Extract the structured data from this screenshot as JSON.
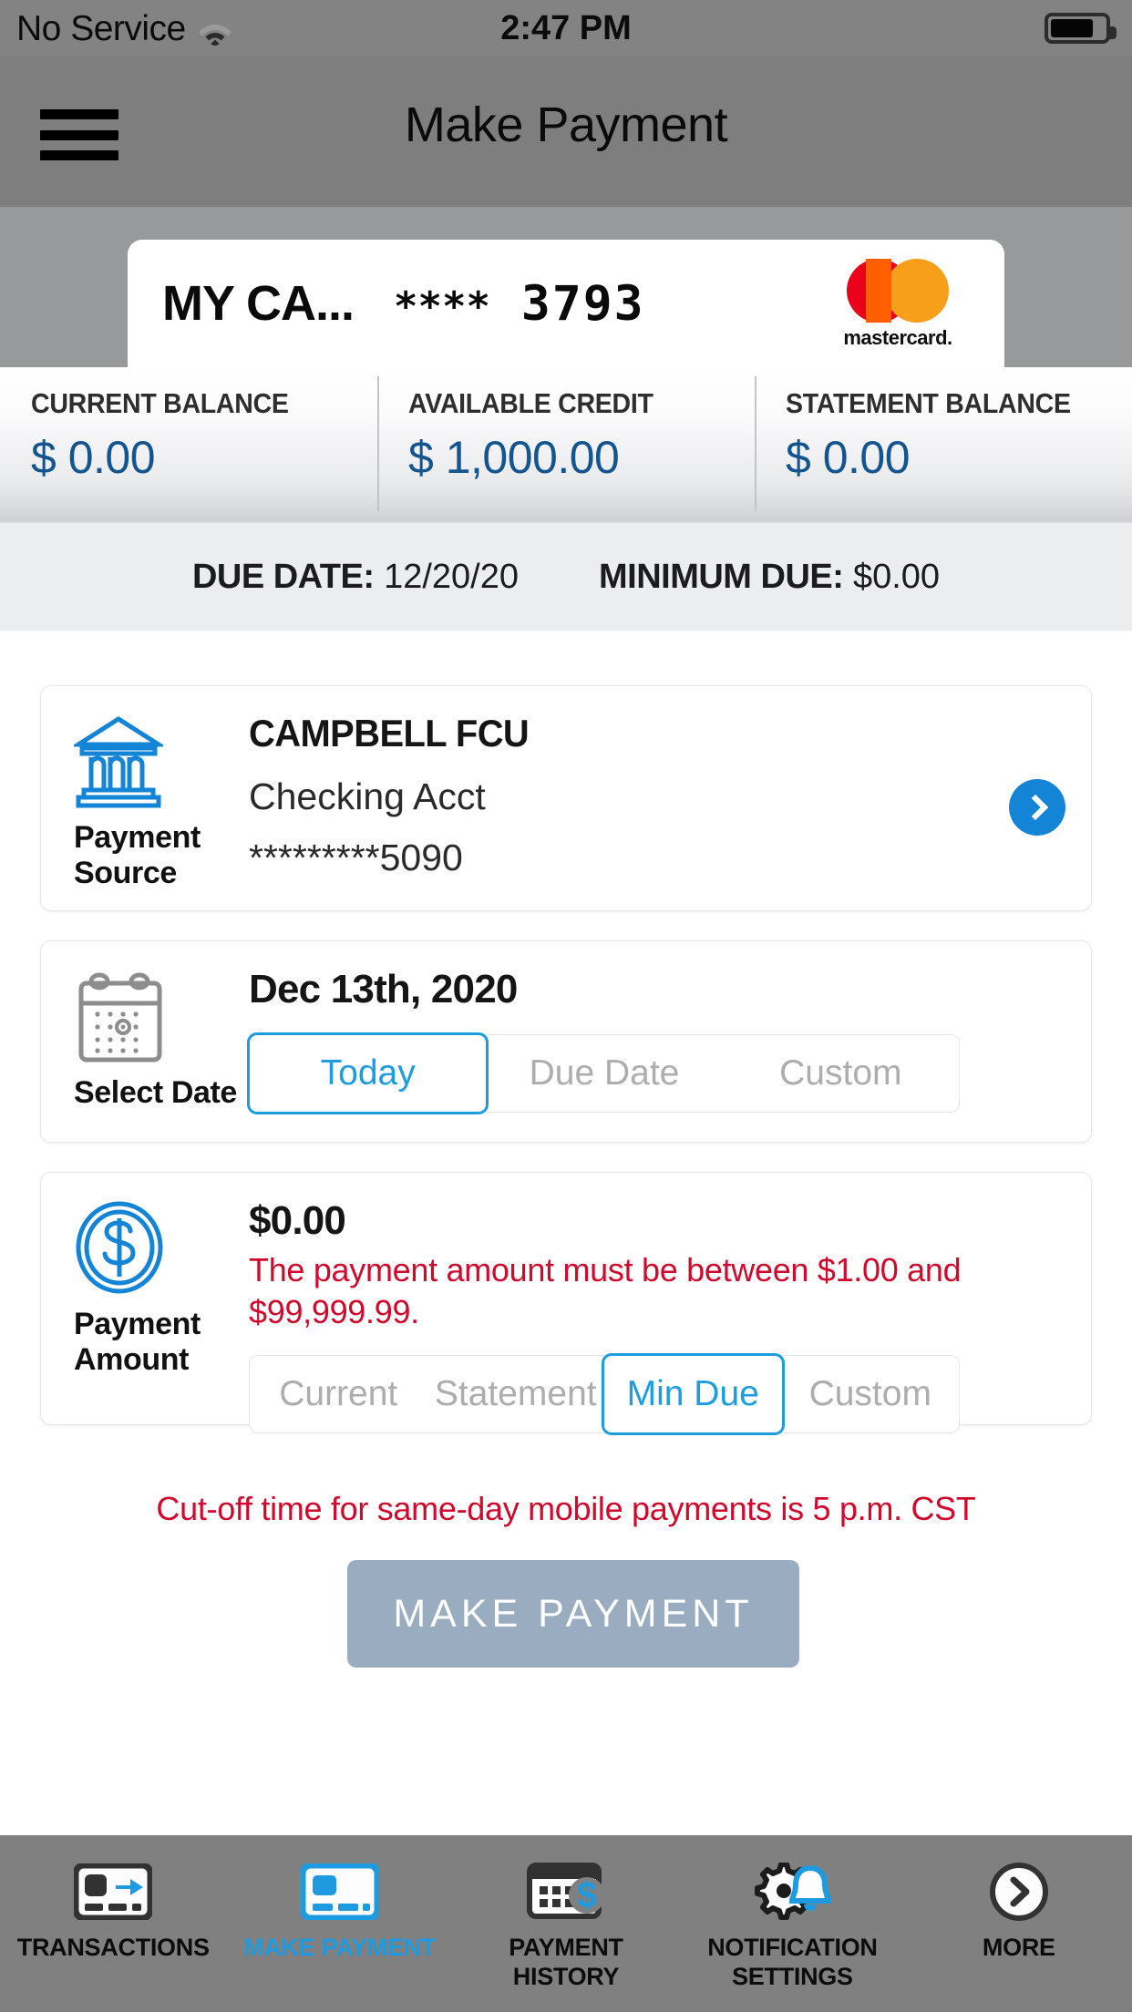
{
  "status_bar": {
    "carrier": "No Service",
    "wifi_icon": "wifi-icon",
    "time": "2:47 PM",
    "battery_icon": "battery-icon",
    "battery_level_pct": 80
  },
  "nav_bar": {
    "menu_icon": "hamburger-menu-icon",
    "title": "Make Payment"
  },
  "account_card": {
    "nickname": "MY CA...",
    "masked_stars": "****",
    "last_four": "3793",
    "brand": "mastercard",
    "brand_wordmark": "mastercard.",
    "brand_colors": {
      "red": "#EB001B",
      "yellow": "#F79E1B",
      "overlap": "#FF5F00"
    }
  },
  "balances": [
    {
      "label": "CURRENT BALANCE",
      "value": "$ 0.00"
    },
    {
      "label": "AVAILABLE CREDIT",
      "value": "$ 1,000.00"
    },
    {
      "label": "STATEMENT BALANCE",
      "value": "$ 0.00"
    }
  ],
  "due_info": {
    "due_date_label": "DUE DATE:",
    "due_date_value": "12/20/20",
    "minimum_due_label": "MINIMUM DUE:",
    "minimum_due_value": "$0.00"
  },
  "payment_source": {
    "icon": "bank-institution-icon",
    "section_label": "Payment\nSource",
    "section_label_line1": "Payment",
    "section_label_line2": "Source",
    "institution": "CAMPBELL FCU",
    "account_type": "Checking Acct",
    "account_mask": "*********5090",
    "chevron_icon": "chevron-right-icon"
  },
  "select_date": {
    "icon": "calendar-icon",
    "section_label": "Select Date",
    "date_value": "Dec 13th, 2020",
    "options": [
      {
        "label": "Today",
        "selected": true
      },
      {
        "label": "Due Date",
        "selected": false
      },
      {
        "label": "Custom",
        "selected": false
      }
    ]
  },
  "payment_amount": {
    "icon": "dollar-coin-icon",
    "section_label_line1": "Payment",
    "section_label_line2": "Amount",
    "amount_value": "$0.00",
    "error_message": "The payment amount must be between $1.00 and $99,999.99.",
    "options": [
      {
        "label": "Current",
        "selected": false
      },
      {
        "label": "Statement",
        "selected": false
      },
      {
        "label": "Min Due",
        "selected": true
      },
      {
        "label": "Custom",
        "selected": false
      }
    ]
  },
  "footer_note": "Cut-off time for same-day mobile payments is 5 p.m. CST",
  "submit_button": {
    "label": "MAKE PAYMENT",
    "enabled": false,
    "color": "#9aadc0"
  },
  "tab_bar": {
    "accent_color": "#1e9be0",
    "items": [
      {
        "icon": "card-transfer-icon",
        "label_line1": "TRANSACTIONS",
        "label_line2": "",
        "active": false
      },
      {
        "icon": "credit-card-icon",
        "label_line1": "MAKE PAYMENT",
        "label_line2": "",
        "active": true
      },
      {
        "icon": "calendar-dollar-icon",
        "label_line1": "PAYMENT",
        "label_line2": "HISTORY",
        "active": false
      },
      {
        "icon": "gear-bell-icon",
        "label_line1": "NOTIFICATION",
        "label_line2": "SETTINGS",
        "active": false
      },
      {
        "icon": "chevron-circle-icon",
        "label_line1": "MORE",
        "label_line2": "",
        "active": false
      }
    ]
  }
}
